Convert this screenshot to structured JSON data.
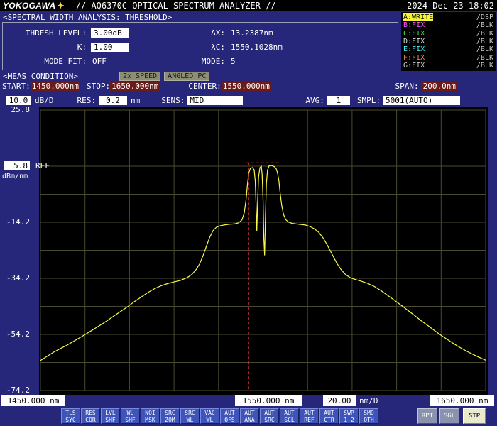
{
  "header": {
    "brand": "YOKOGAWA",
    "logo_mark": "✦",
    "title": "// AQ6370C OPTICAL SPECTRUM ANALYZER //",
    "datetime": "2024 Dec 23 18:02"
  },
  "analysis": {
    "title": "<SPECTRAL WIDTH ANALYSIS: THRESHOLD>",
    "fields_left": [
      {
        "label": "THRESH LEVEL:",
        "value": "3.00dB"
      },
      {
        "label": "K:",
        "value": "1.00"
      },
      {
        "label": "MODE FIT:",
        "value": "OFF"
      }
    ],
    "fields_right": [
      {
        "label": "ΔX:",
        "value": "13.2387nm"
      },
      {
        "label": "λC:",
        "value": "1550.1028nm"
      },
      {
        "label": "MODE:",
        "value": "5"
      }
    ]
  },
  "traces": [
    {
      "id": "A:WRITE",
      "status": "/DSP",
      "fg": "#101000",
      "bg": "#f5f533"
    },
    {
      "id": "B:FIX",
      "status": "/BLK",
      "fg": "#ff55ff"
    },
    {
      "id": "C:FIX",
      "status": "/BLK",
      "fg": "#44ee44"
    },
    {
      "id": "D:FIX",
      "status": "/BLK",
      "fg": "#dcdcdc"
    },
    {
      "id": "E:FIX",
      "status": "/BLK",
      "fg": "#44eeee"
    },
    {
      "id": "F:FIX",
      "status": "/BLK",
      "fg": "#ff8844"
    },
    {
      "id": "G:FIX",
      "status": "/BLK",
      "fg": "#cccccc"
    }
  ],
  "meas": {
    "label": "<MEAS CONDITION>",
    "badges": [
      "2x SPEED",
      "ANGLED PC"
    ],
    "start_label": "START:",
    "start_value": "1450.000nm",
    "stop_label": "STOP:",
    "stop_value": "1650.000nm",
    "center_label": "CENTER:",
    "center_value": "1550.000nm",
    "span_label": "SPAN:",
    "span_value": "200.0nm"
  },
  "settings": {
    "level_scale": "10.0",
    "level_scale_unit": "dB/D",
    "res_label": "RES:",
    "res_value": "0.2",
    "res_unit": "nm",
    "sens_label": "SENS:",
    "sens_value": "MID",
    "avg_label": "AVG:",
    "avg_value": "1",
    "smpl_label": "SMPL:",
    "smpl_value": "5001(AUTO)"
  },
  "graph": {
    "y_labels": [
      "25.8",
      "5.8",
      "-14.2",
      "-34.2",
      "-54.2",
      "-74.2"
    ],
    "ref_label": "REF",
    "y_unit": "dBm/nm",
    "x_start": "1450.000 nm",
    "x_center": "1550.000 nm",
    "x_div_value": "20.00",
    "x_div_unit": "nm/D",
    "x_stop": "1650.000 nm"
  },
  "chart_data": {
    "type": "line",
    "title": "Optical spectrum trace A",
    "x_unit": "nm",
    "y_unit": "dBm/nm",
    "x_range": [
      1450,
      1650
    ],
    "y_range": [
      -74.2,
      25.8
    ],
    "x_per_div": 20.0,
    "y_per_div": 10.0,
    "ref_level_dbm": 5.8,
    "grid": true,
    "trace_color": "#f8f84a",
    "grid_color": "#4a4a30",
    "series": [
      {
        "name": "A",
        "points": [
          [
            1450,
            -63.5
          ],
          [
            1453,
            -62
          ],
          [
            1456,
            -60.5
          ],
          [
            1459,
            -59.2
          ],
          [
            1462,
            -58
          ],
          [
            1465,
            -56.6
          ],
          [
            1468,
            -55.2
          ],
          [
            1471,
            -53.8
          ],
          [
            1474,
            -52.3
          ],
          [
            1477,
            -50.8
          ],
          [
            1480,
            -49.3
          ],
          [
            1483,
            -47.6
          ],
          [
            1486,
            -46
          ],
          [
            1489,
            -44.4
          ],
          [
            1492,
            -42.6
          ],
          [
            1495,
            -41
          ],
          [
            1498,
            -39.4
          ],
          [
            1501,
            -38
          ],
          [
            1504,
            -36.9
          ],
          [
            1507,
            -36.1
          ],
          [
            1510,
            -35.5
          ],
          [
            1513,
            -34.9
          ],
          [
            1516,
            -33.9
          ],
          [
            1518,
            -32.8
          ],
          [
            1520,
            -31
          ],
          [
            1521.5,
            -29
          ],
          [
            1523,
            -26.2
          ],
          [
            1524.5,
            -22.8
          ],
          [
            1526,
            -19.6
          ],
          [
            1527.5,
            -17.2
          ],
          [
            1529,
            -16
          ],
          [
            1531,
            -15.4
          ],
          [
            1533,
            -15.1
          ],
          [
            1535,
            -14.9
          ],
          [
            1537,
            -14.8
          ],
          [
            1539,
            -14.4
          ],
          [
            1540.5,
            -13.4
          ],
          [
            1541.5,
            -11
          ],
          [
            1542.3,
            -6.5
          ],
          [
            1543,
            -0.5
          ],
          [
            1543.6,
            3.4
          ],
          [
            1544.3,
            5
          ],
          [
            1545.2,
            5.3
          ],
          [
            1546,
            4.5
          ],
          [
            1546.5,
            0.5
          ],
          [
            1546.9,
            -9
          ],
          [
            1547.2,
            -17.5
          ],
          [
            1547.6,
            -6
          ],
          [
            1548,
            2
          ],
          [
            1548.6,
            5.3
          ],
          [
            1549.2,
            5.8
          ],
          [
            1549.6,
            3
          ],
          [
            1550,
            -6
          ],
          [
            1550.35,
            -20
          ],
          [
            1550.7,
            -26
          ],
          [
            1551.1,
            -12
          ],
          [
            1551.5,
            -0.5
          ],
          [
            1552,
            4.4
          ],
          [
            1552.7,
            5.9
          ],
          [
            1553.5,
            6.1
          ],
          [
            1554.3,
            5.9
          ],
          [
            1555.1,
            5.6
          ],
          [
            1555.9,
            4.9
          ],
          [
            1556.5,
            3.4
          ],
          [
            1557.1,
            0.6
          ],
          [
            1557.7,
            -3.8
          ],
          [
            1558.4,
            -8.2
          ],
          [
            1559.2,
            -11.4
          ],
          [
            1560.2,
            -13.3
          ],
          [
            1561.5,
            -14.2
          ],
          [
            1563,
            -14.6
          ],
          [
            1565,
            -14.8
          ],
          [
            1567,
            -15
          ],
          [
            1569,
            -15.2
          ],
          [
            1571,
            -15.7
          ],
          [
            1573,
            -16.5
          ],
          [
            1575,
            -17.8
          ],
          [
            1577,
            -19.8
          ],
          [
            1579,
            -22.5
          ],
          [
            1581,
            -25.6
          ],
          [
            1583,
            -28.6
          ],
          [
            1585,
            -31
          ],
          [
            1587,
            -32.8
          ],
          [
            1589,
            -33.9
          ],
          [
            1591,
            -34.5
          ],
          [
            1594,
            -35.2
          ],
          [
            1597,
            -36
          ],
          [
            1600,
            -37.1
          ],
          [
            1603,
            -38.6
          ],
          [
            1606,
            -40.3
          ],
          [
            1609,
            -42
          ],
          [
            1612,
            -43.8
          ],
          [
            1615,
            -45.6
          ],
          [
            1618,
            -47.4
          ],
          [
            1621,
            -49.3
          ],
          [
            1624,
            -51
          ],
          [
            1627,
            -52.8
          ],
          [
            1630,
            -54.5
          ],
          [
            1633,
            -56.1
          ],
          [
            1636,
            -57.7
          ],
          [
            1639,
            -59.1
          ],
          [
            1642,
            -60.4
          ],
          [
            1645,
            -61.6
          ],
          [
            1648,
            -62.7
          ],
          [
            1650,
            -63.4
          ]
        ]
      }
    ],
    "markers": {
      "color": "#ff4040",
      "vlines_x": [
        1543.5,
        1556.7
      ],
      "vline_top": 7.0,
      "hline_y": 7.0,
      "hline_x": [
        1542.4,
        1557.8
      ]
    }
  },
  "toolbar": {
    "softkeys": [
      {
        "l1": "TLS",
        "l2": "SYC"
      },
      {
        "l1": "RES",
        "l2": "COR"
      },
      {
        "l1": "LVL",
        "l2": "SHF"
      },
      {
        "l1": "WL",
        "l2": "SHF"
      },
      {
        "l1": "NOI",
        "l2": "MSK"
      },
      {
        "l1": "SRC",
        "l2": "ZOM"
      },
      {
        "l1": "SRC",
        "l2": "WL"
      },
      {
        "l1": "VAC",
        "l2": "WL"
      },
      {
        "l1": "AUT",
        "l2": "OFS"
      },
      {
        "l1": "AUT",
        "l2": "ANA"
      },
      {
        "l1": "AUT",
        "l2": "SRC"
      },
      {
        "l1": "AUT",
        "l2": "SCL"
      },
      {
        "l1": "AUT",
        "l2": "REF"
      },
      {
        "l1": "AUT",
        "l2": "CTR"
      },
      {
        "l1": "SWP",
        "l2": "1-2"
      },
      {
        "l1": "SMO",
        "l2": "OTH"
      }
    ],
    "rpt": "RPT",
    "sgl": "SGL",
    "stp": "STP"
  }
}
